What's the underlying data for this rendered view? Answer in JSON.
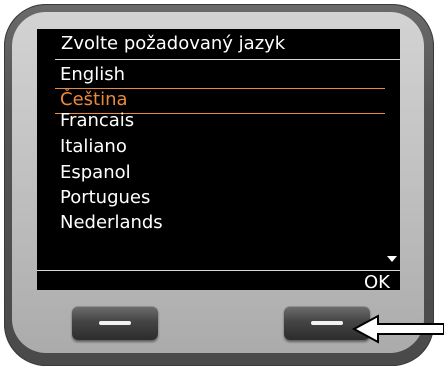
{
  "screen": {
    "title": "Zvolte požadovaný jazyk",
    "languages": [
      {
        "label": "English",
        "selected": false
      },
      {
        "label": "Čeština",
        "selected": true
      },
      {
        "label": "Francais",
        "selected": false
      },
      {
        "label": "Italiano",
        "selected": false
      },
      {
        "label": "Espanol",
        "selected": false
      },
      {
        "label": "Portugues",
        "selected": false
      },
      {
        "label": "Nederlands",
        "selected": false
      }
    ],
    "softkeys": {
      "left_label": "",
      "right_label": "OK"
    },
    "icons": {
      "scroll": "scroll-down-arrow-icon",
      "pointer": "pointer-arrow-icon"
    }
  },
  "colors": {
    "screen_bg": "#000000",
    "text": "#ffffff",
    "highlight": "#e98a3c",
    "bezel": "#4a4a4a",
    "panel": "#c6c6c6"
  }
}
